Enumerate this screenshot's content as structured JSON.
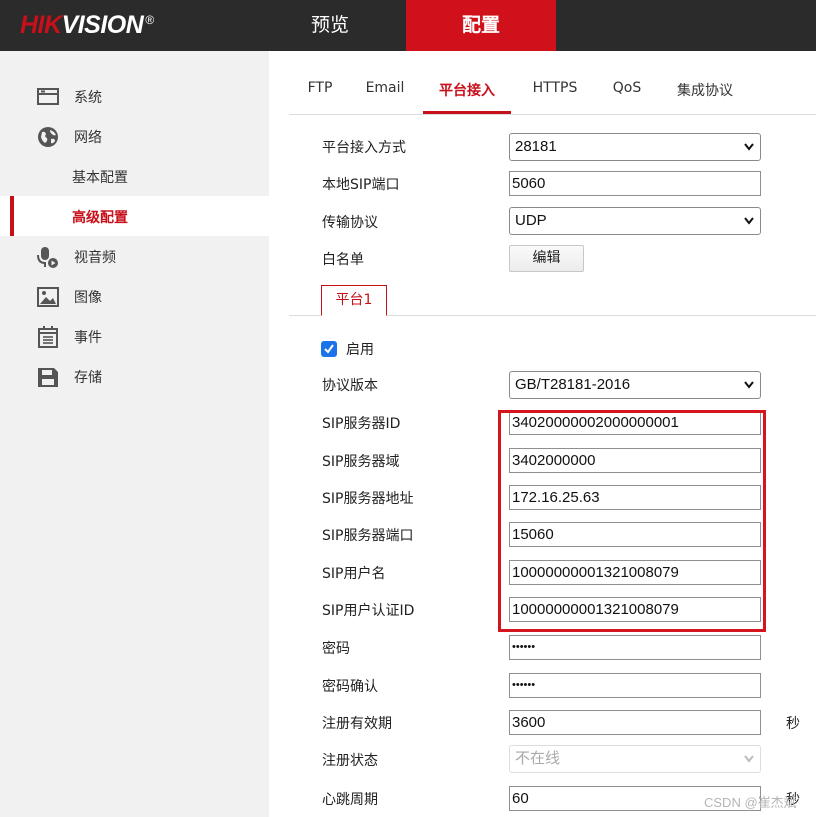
{
  "header": {
    "logo_brand": "HIK",
    "logo_rest": "VISION",
    "logo_mark": "®",
    "nav": {
      "preview": "预览",
      "config": "配置"
    }
  },
  "sidebar": {
    "items": [
      {
        "label": "系统",
        "icon": "monitor-icon"
      },
      {
        "label": "网络",
        "icon": "globe-icon"
      },
      {
        "label": "基本配置"
      },
      {
        "label": "高级配置",
        "active": true
      },
      {
        "label": "视音频",
        "icon": "microphone-video-icon"
      },
      {
        "label": "图像",
        "icon": "image-icon"
      },
      {
        "label": "事件",
        "icon": "calendar-icon"
      },
      {
        "label": "存储",
        "icon": "save-disk-icon"
      }
    ]
  },
  "tabs": [
    "FTP",
    "Email",
    "平台接入",
    "HTTPS",
    "QoS",
    "集成协议"
  ],
  "active_tab": "平台接入",
  "form": {
    "access_mode": {
      "label": "平台接入方式",
      "value": "28181"
    },
    "local_sip_port": {
      "label": "本地SIP端口",
      "value": "5060"
    },
    "transport": {
      "label": "传输协议",
      "value": "UDP"
    },
    "whitelist": {
      "label": "白名单",
      "button": "编辑"
    },
    "platform_tab": "平台1",
    "enable": {
      "label": "启用",
      "checked": true
    },
    "protocol_version": {
      "label": "协议版本",
      "value": "GB/T28181-2016"
    },
    "sip_server_id": {
      "label": "SIP服务器ID",
      "value": "34020000002000000001"
    },
    "sip_server_domain": {
      "label": "SIP服务器域",
      "value": "3402000000"
    },
    "sip_server_addr": {
      "label": "SIP服务器地址",
      "value": "172.16.25.63"
    },
    "sip_server_port": {
      "label": "SIP服务器端口",
      "value": "15060"
    },
    "sip_username": {
      "label": "SIP用户名",
      "value": "10000000001321008079"
    },
    "sip_auth_id": {
      "label": "SIP用户认证ID",
      "value": "10000000001321008079"
    },
    "password": {
      "label": "密码",
      "value": "••••••"
    },
    "password_confirm": {
      "label": "密码确认",
      "value": "••••••"
    },
    "register_period": {
      "label": "注册有效期",
      "value": "3600",
      "unit": "秒"
    },
    "register_status": {
      "label": "注册状态",
      "value": "不在线"
    },
    "heartbeat": {
      "label": "心跳周期",
      "value": "60",
      "unit": "秒"
    }
  },
  "watermark": "CSDN @崔杰斌",
  "colors": {
    "accent": "#c8101b",
    "topbar": "#2b2b2b",
    "sidebar": "#f1f1f1",
    "checkbox": "#1a73e8"
  }
}
